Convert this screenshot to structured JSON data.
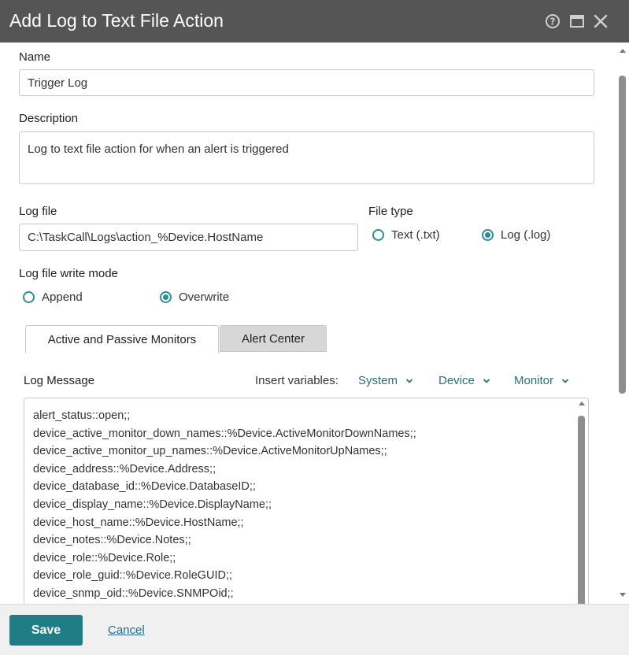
{
  "dialog": {
    "title": "Add Log to Text File Action"
  },
  "titlebar_icons": [
    "help-icon",
    "maximize-icon",
    "close-icon"
  ],
  "form": {
    "name_label": "Name",
    "name_value": "Trigger Log",
    "description_label": "Description",
    "description_value": "Log to text file action for when an alert is triggered",
    "logfile_label": "Log file",
    "logfile_value": "C:\\TaskCall\\Logs\\action_%Device.HostName",
    "filetype_label": "File type",
    "filetype_options": [
      {
        "label": "Text (.txt)",
        "selected": false
      },
      {
        "label": "Log (.log)",
        "selected": true
      }
    ],
    "writemode_label": "Log file write mode",
    "writemode_options": [
      {
        "label": "Append",
        "selected": false
      },
      {
        "label": "Overwrite",
        "selected": true
      }
    ]
  },
  "tabs": [
    {
      "label": "Active and Passive Monitors",
      "active": true
    },
    {
      "label": "Alert Center",
      "active": false
    }
  ],
  "log_message": {
    "label": "Log Message",
    "insert_label": "Insert variables:",
    "menus": [
      "System",
      "Device",
      "Monitor"
    ],
    "lines": [
      "alert_status::open;;",
      "device_active_monitor_down_names::%Device.ActiveMonitorDownNames;;",
      "device_active_monitor_up_names::%Device.ActiveMonitorUpNames;;",
      "device_address::%Device.Address;;",
      "device_database_id::%Device.DatabaseID;;",
      "device_display_name::%Device.DisplayName;;",
      "device_host_name::%Device.HostName;;",
      "device_notes::%Device.Notes;;",
      "device_role::%Device.Role;;",
      "device_role_guid::%Device.RoleGUID;;",
      "device_snmp_oid::%Device.SNMPOid;;"
    ]
  },
  "footer": {
    "save_label": "Save",
    "cancel_label": "Cancel"
  },
  "colors": {
    "accent": "#2a8c97",
    "save_button": "#1f7d85",
    "titlebar": "#555555"
  }
}
